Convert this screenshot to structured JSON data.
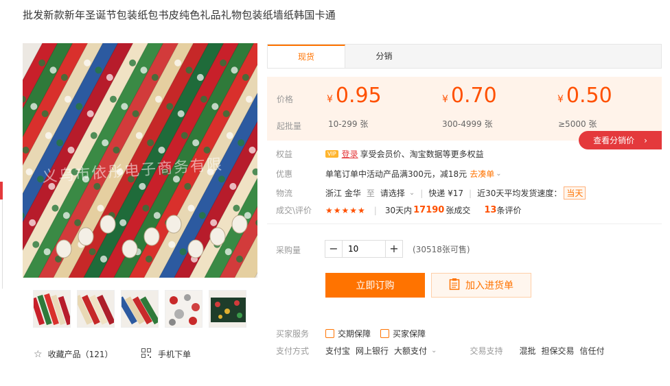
{
  "product": {
    "title": "批发新款新年圣诞节包装纸包书皮纯色礼品礼物包装纸墙纸韩国卡通",
    "watermark": "义乌市依彤电子商务有限"
  },
  "gallery": {
    "thumb_count": 5,
    "favorite_label": "收藏产品（121）",
    "mobile_label": "手机下单"
  },
  "tabs": [
    {
      "label": "现货"
    },
    {
      "label": "分销"
    }
  ],
  "pricing": {
    "price_label": "价格",
    "moq_label": "起批量",
    "currency": "¥",
    "tiers": [
      {
        "price": "0.95",
        "range": "10-299 张"
      },
      {
        "price": "0.70",
        "range": "300-4999 张"
      },
      {
        "price": "0.50",
        "range": "≥5000 张"
      }
    ],
    "distribution_button": "查看分销价"
  },
  "info": {
    "benefits": {
      "label": "权益",
      "vip": "VIP",
      "login_link": "登录",
      "text": "享受会员价、淘宝数据等更多权益"
    },
    "promo": {
      "label": "优惠",
      "text": "单笔订单中活动产品满300元，减18元",
      "link": "去凑单"
    },
    "logistics": {
      "label": "物流",
      "origin": "浙江 金华",
      "to": "至",
      "destination": "请选择",
      "express": "快递 ¥17",
      "speed_label": "近30天平均发货速度：",
      "speed_value": "当天"
    },
    "deals": {
      "label": "成交\\评价",
      "rating": 4.5,
      "stars": "★★★★★",
      "sales_prefix": "30天内",
      "sales_count": "17190",
      "sales_suffix": "张成交",
      "review_count": "13",
      "review_suffix": "条评价"
    }
  },
  "purchase": {
    "label": "采购量",
    "quantity": "10",
    "stock": "(30518张可售)",
    "buy_now": "立即订购",
    "add_to_list": "加入进货单"
  },
  "services": {
    "buyer_label": "买家服务",
    "buyer_items": [
      "交期保障",
      "买家保障"
    ],
    "payment_label": "支付方式",
    "payment_items": [
      "支付宝",
      "网上银行",
      "大额支付"
    ],
    "trade_label": "交易支持",
    "trade_items": [
      "混批",
      "担保交易",
      "信任付"
    ]
  }
}
